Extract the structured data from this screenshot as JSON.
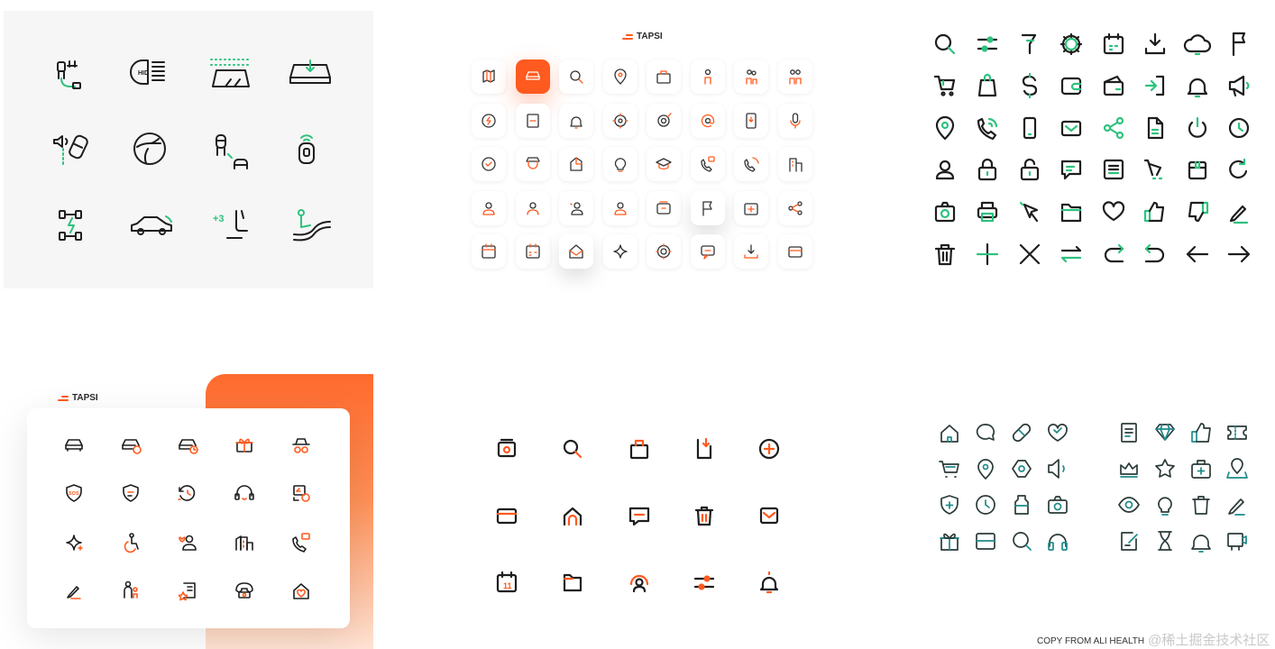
{
  "colors": {
    "accent_green": "#2ec27e",
    "accent_orange": "#ff5a1f",
    "ink": "#1e1e1e",
    "teal": "#1f8a8a"
  },
  "panel1": {
    "icons": [
      "seat-adjust-icon",
      "hid-headlight-icon",
      "windshield-washer-icon",
      "windshield-defrost-icon",
      "proximity-alert-car-icon",
      "steering-wheel-icon",
      "driver-passenger-icon",
      "key-fob-icon",
      "drivetrain-icon",
      "sedan-car-icon",
      "seat-plus-three-icon",
      "seat-heater-icon"
    ],
    "label_hid": "HID",
    "label_plus": "+3"
  },
  "panel2": {
    "brand": "TAPSI",
    "icons": [
      "map-icon",
      "car-icon",
      "search-icon",
      "location-pin-icon",
      "briefcase-icon",
      "person-icon",
      "two-people-icon",
      "group-icon",
      "lightning-icon",
      "document-icon",
      "bell-icon",
      "crosshair-icon",
      "target-icon",
      "at-sign-icon",
      "phone-download-icon",
      "microphone-icon",
      "check-circle-icon",
      "driver-hat-icon",
      "pie-chart-icon",
      "lightbulb-icon",
      "graduation-cap-icon",
      "phone-chat-icon",
      "phone-call-icon",
      "building-icon",
      "user-badge-icon",
      "user-icon",
      "user-star-icon",
      "user-group-icon",
      "wallet-icon",
      "flag-icon",
      "first-aid-icon",
      "share-icon",
      "calendar-icon",
      "calendar-grid-icon",
      "envelope-open-icon",
      "sparkle-icon",
      "settings-icon",
      "chat-bubble-icon",
      "download-icon",
      "credit-card-icon"
    ]
  },
  "panel3": {
    "icons": [
      "search-icon",
      "sliders-icon",
      "cocktail-icon",
      "gear-icon",
      "calendar-icon",
      "download-icon",
      "cloud-icon",
      "flag-icon",
      "cart-icon",
      "shopping-bag-icon",
      "dollar-icon",
      "wallet-icon",
      "credit-card-icon",
      "login-icon",
      "bell-icon",
      "megaphone-icon",
      "location-pin-icon",
      "phone-icon",
      "mobile-icon",
      "mail-icon",
      "share-icon",
      "document-icon",
      "power-icon",
      "clock-icon",
      "user-icon",
      "lock-icon",
      "unlock-icon",
      "chat-icon",
      "list-icon",
      "cart-ribbon-icon",
      "package-icon",
      "refresh-icon",
      "camera-icon",
      "printer-icon",
      "pointer-icon",
      "folder-icon",
      "heart-icon",
      "thumbs-up-icon",
      "thumbs-down-icon",
      "pencil-icon",
      "trash-icon",
      "plus-icon",
      "close-icon",
      "swap-icon",
      "redo-icon",
      "undo-icon",
      "arrow-left-icon",
      "arrow-right-icon"
    ]
  },
  "panel4": {
    "brand": "TAPSI",
    "sos": "SOS",
    "icons": [
      "car-icon",
      "car-check-icon",
      "car-clock-icon",
      "gift-icon",
      "incognito-icon",
      "sos-shield-icon",
      "shield-icon",
      "history-icon",
      "headset-icon",
      "schedule-icon",
      "sparkle-icon",
      "accessibility-icon",
      "user-heart-icon",
      "city-icon",
      "phone-chat-icon",
      "pencil-icon",
      "family-icon",
      "receipt-star-icon",
      "phone-cash-icon",
      "home-heart-icon"
    ]
  },
  "panel5": {
    "calendar_day": "11",
    "icons": [
      "wallet-icon",
      "search-icon",
      "briefcase-icon",
      "phone-download-icon",
      "plus-circle-icon",
      "card-icon",
      "home-icon",
      "chat-icon",
      "trash-icon",
      "mail-icon",
      "calendar-icon",
      "folder-icon",
      "user-circle-icon",
      "sliders-icon",
      "bell-icon"
    ]
  },
  "panel6": {
    "icons": [
      "home-icon",
      "chat-icon",
      "pill-icon",
      "heart-icon",
      "cart-icon",
      "location-pin-icon",
      "hexagon-icon",
      "speaker-icon",
      "shield-plus-icon",
      "clock-icon",
      "bottle-icon",
      "camera-icon",
      "gift-icon",
      "card-icon",
      "search-icon",
      "headphones-icon",
      "document-icon",
      "gem-icon",
      "thumbs-up-icon",
      "ticket-icon",
      "crown-icon",
      "star-icon",
      "first-aid-icon",
      "map-pin-icon",
      "eye-icon",
      "lightbulb-icon",
      "trash-icon",
      "pencil-icon",
      "note-icon",
      "hourglass-icon",
      "bell-icon",
      "tv-icon"
    ]
  },
  "footer": {
    "copy": "COPY FROM ALI HEALTH",
    "watermark": "@稀土掘金技术社区"
  }
}
